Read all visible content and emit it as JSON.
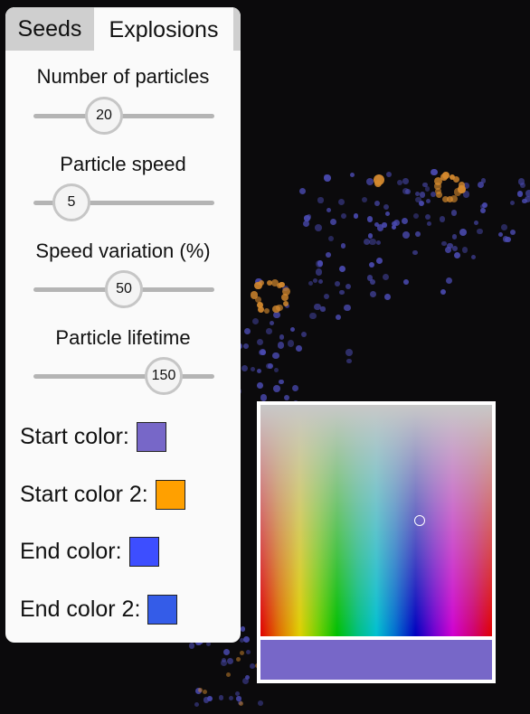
{
  "tabs": [
    {
      "label": "Seeds",
      "active": false
    },
    {
      "label": "Explosions",
      "active": true
    }
  ],
  "sliders": [
    {
      "label": "Number of particles",
      "value": "20",
      "fraction": 0.39
    },
    {
      "label": "Particle speed",
      "value": "5",
      "fraction": 0.21
    },
    {
      "label": "Speed variation (%)",
      "value": "50",
      "fraction": 0.5
    },
    {
      "label": "Particle lifetime",
      "value": "150",
      "fraction": 0.72
    }
  ],
  "colors": [
    {
      "label": "Start color:",
      "hex": "#7767c8"
    },
    {
      "label": "Start color 2:",
      "hex": "#ffa000"
    },
    {
      "label": "End color:",
      "hex": "#3d4eff"
    },
    {
      "label": "End color 2:",
      "hex": "#345ce8"
    }
  ],
  "picker": {
    "selected_hex": "#7767c8"
  },
  "particle_colors": {
    "blue": "#4a4ab0",
    "orange": "#d4892e"
  }
}
